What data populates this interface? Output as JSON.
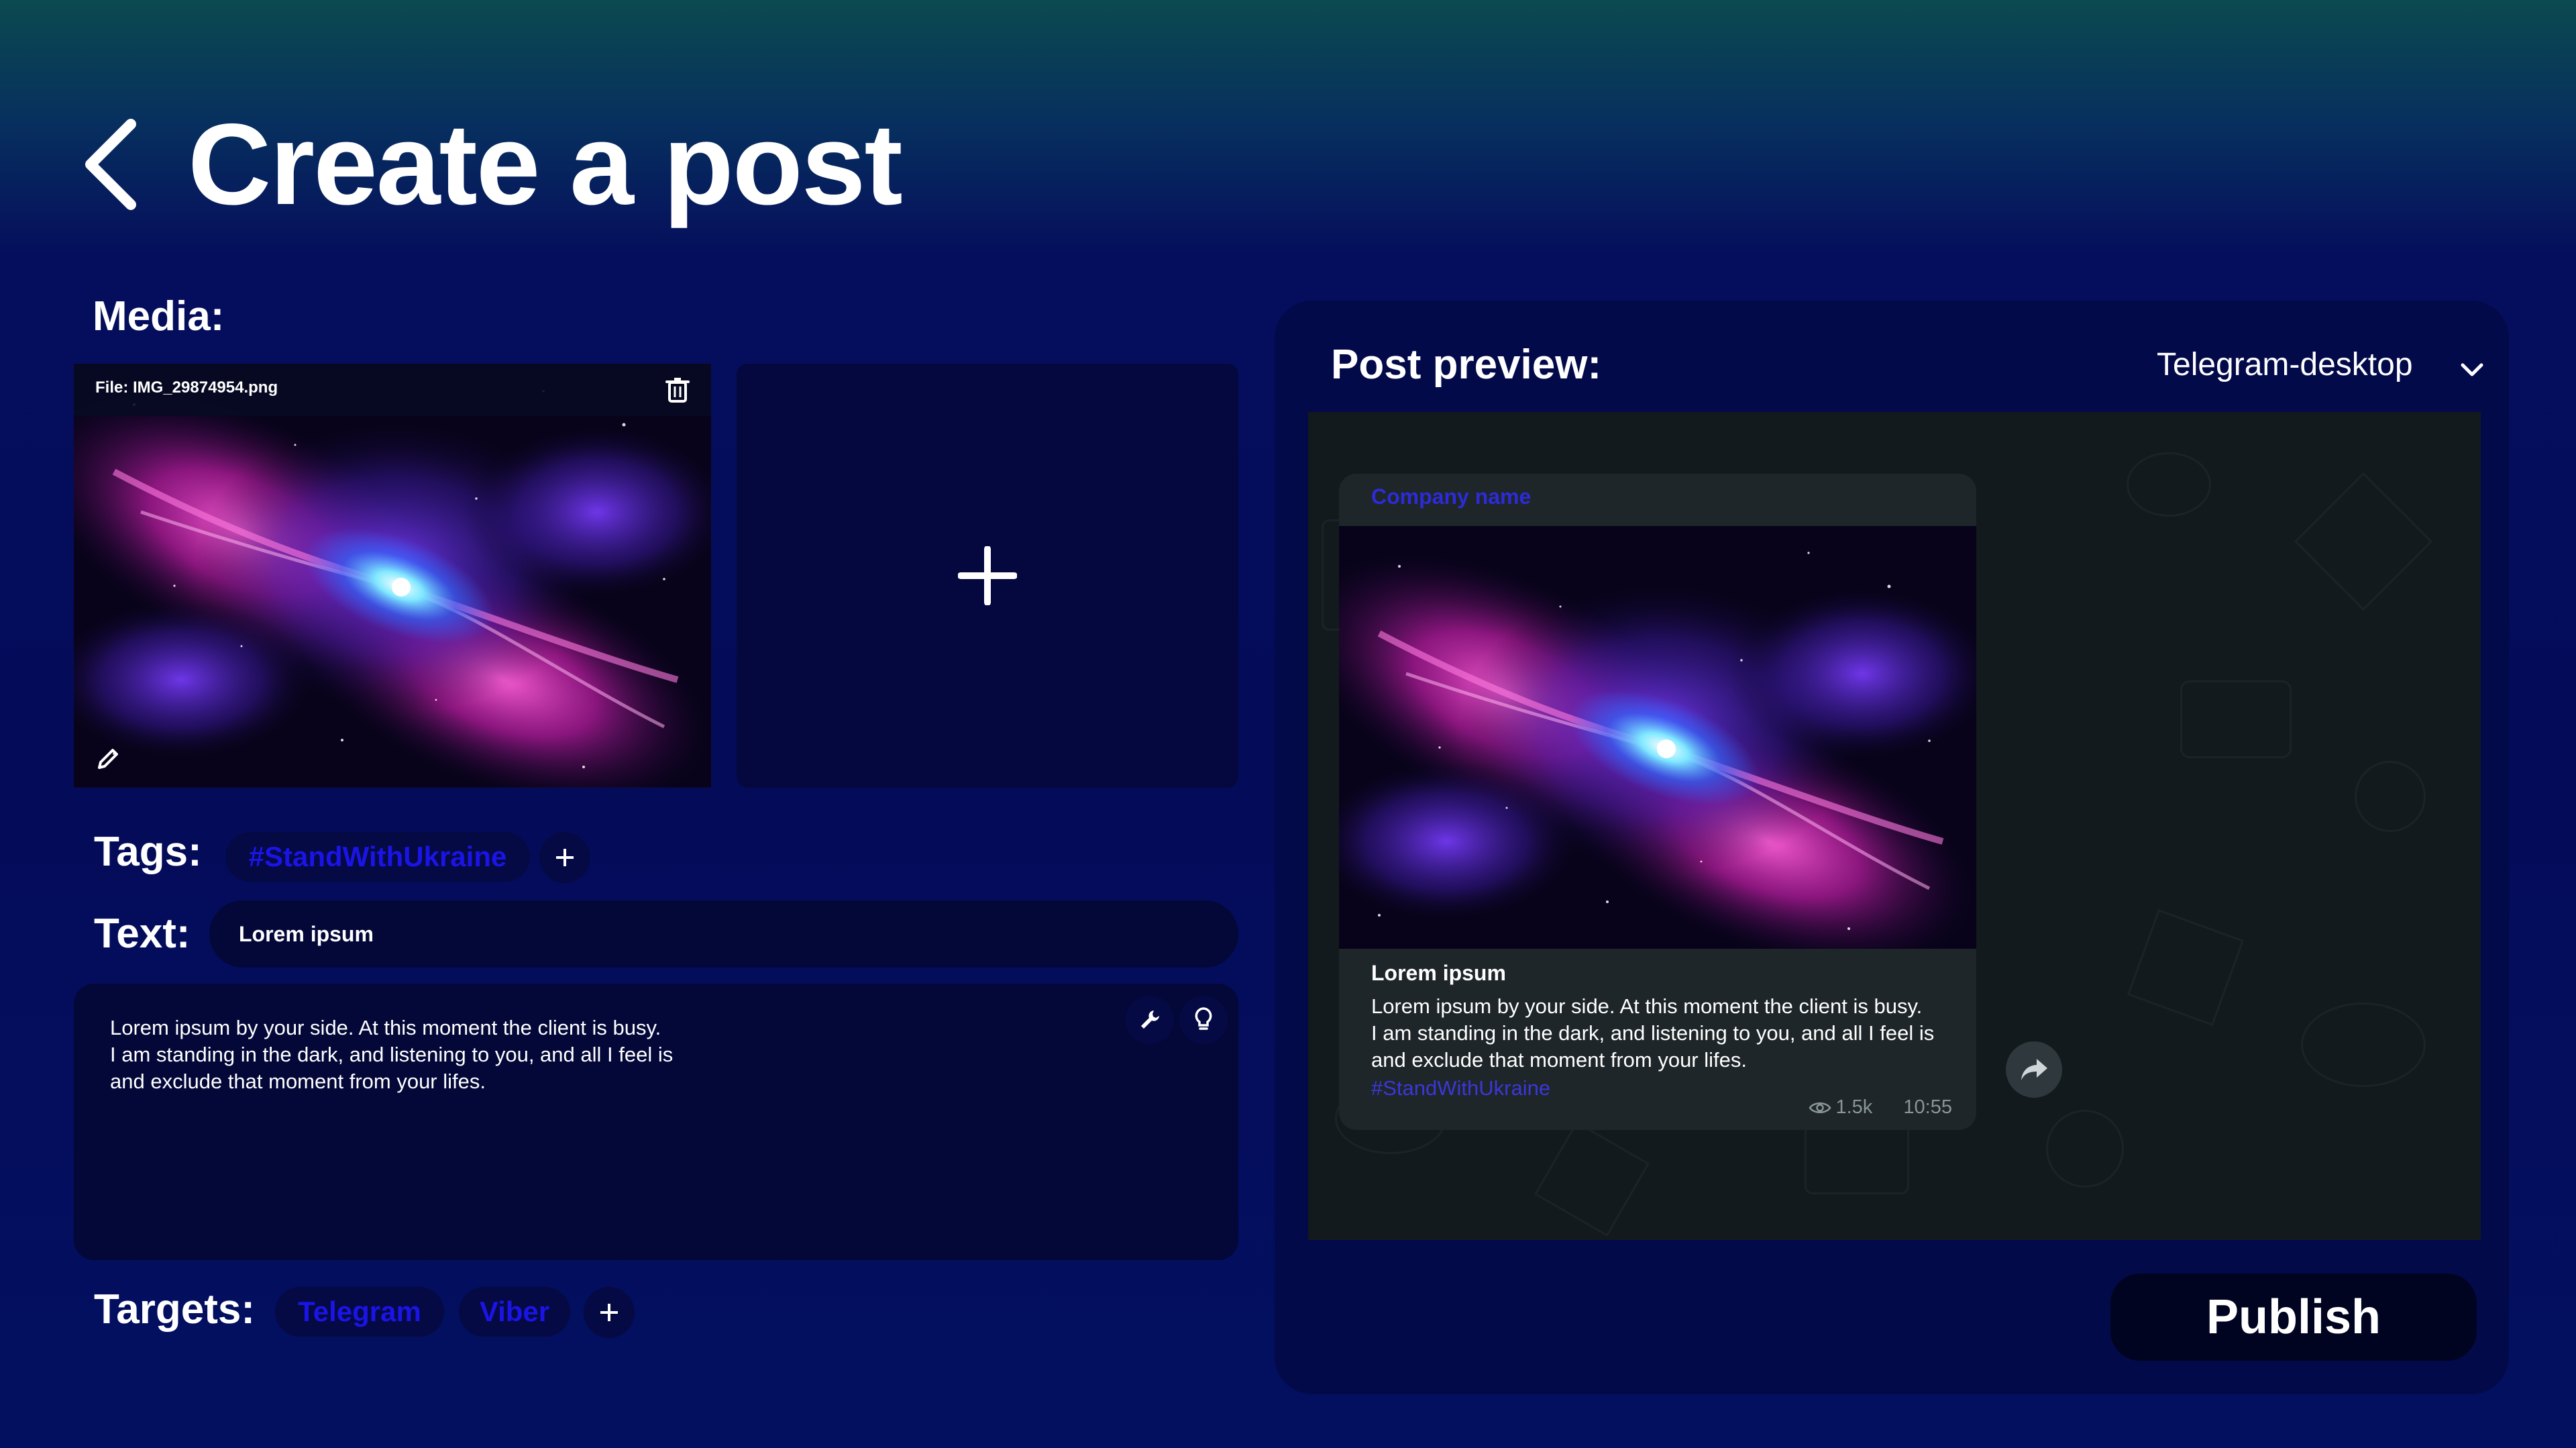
{
  "page": {
    "title": "Create a post",
    "back_icon": "chevron-left-icon"
  },
  "media": {
    "label": "Media:",
    "items": [
      {
        "file_label": "File: IMG_29874954.png",
        "delete_icon": "trash-icon",
        "edit_icon": "pencil-icon"
      }
    ],
    "add_icon": "plus-icon"
  },
  "tags": {
    "label": "Tags:",
    "items": [
      "#StandWithUkraine"
    ],
    "add_icon": "plus-icon"
  },
  "text": {
    "label": "Text:",
    "title_value": "Lorem ipsum",
    "body_lines": [
      "Lorem ipsum by your side. At this moment the client is busy.",
      "I am standing in the dark, and listening to you, and all I feel is",
      "and exclude that moment from your lifes."
    ],
    "tool_icons": [
      "wrench-icon",
      "lightbulb-icon"
    ]
  },
  "targets": {
    "label": "Targets:",
    "items": [
      "Telegram",
      "Viber"
    ],
    "add_icon": "plus-icon"
  },
  "preview": {
    "label": "Post preview:",
    "platform": "Telegram-desktop",
    "company": "Company name",
    "post_title": "Lorem ipsum",
    "post_body_lines": [
      "Lorem ipsum by your side. At this moment the client is busy.",
      "I am standing in the dark, and listening to you, and all I feel is",
      "and exclude that moment from your lifes."
    ],
    "post_tag": "#StandWithUkraine",
    "views": "1.5k",
    "time": "10:55",
    "share_icon": "share-arrow-icon"
  },
  "actions": {
    "publish": "Publish"
  },
  "colors": {
    "accent": "#1a14e6",
    "link": "#3b37d9",
    "panel": "#030a49",
    "bubble": "#1e2629"
  }
}
